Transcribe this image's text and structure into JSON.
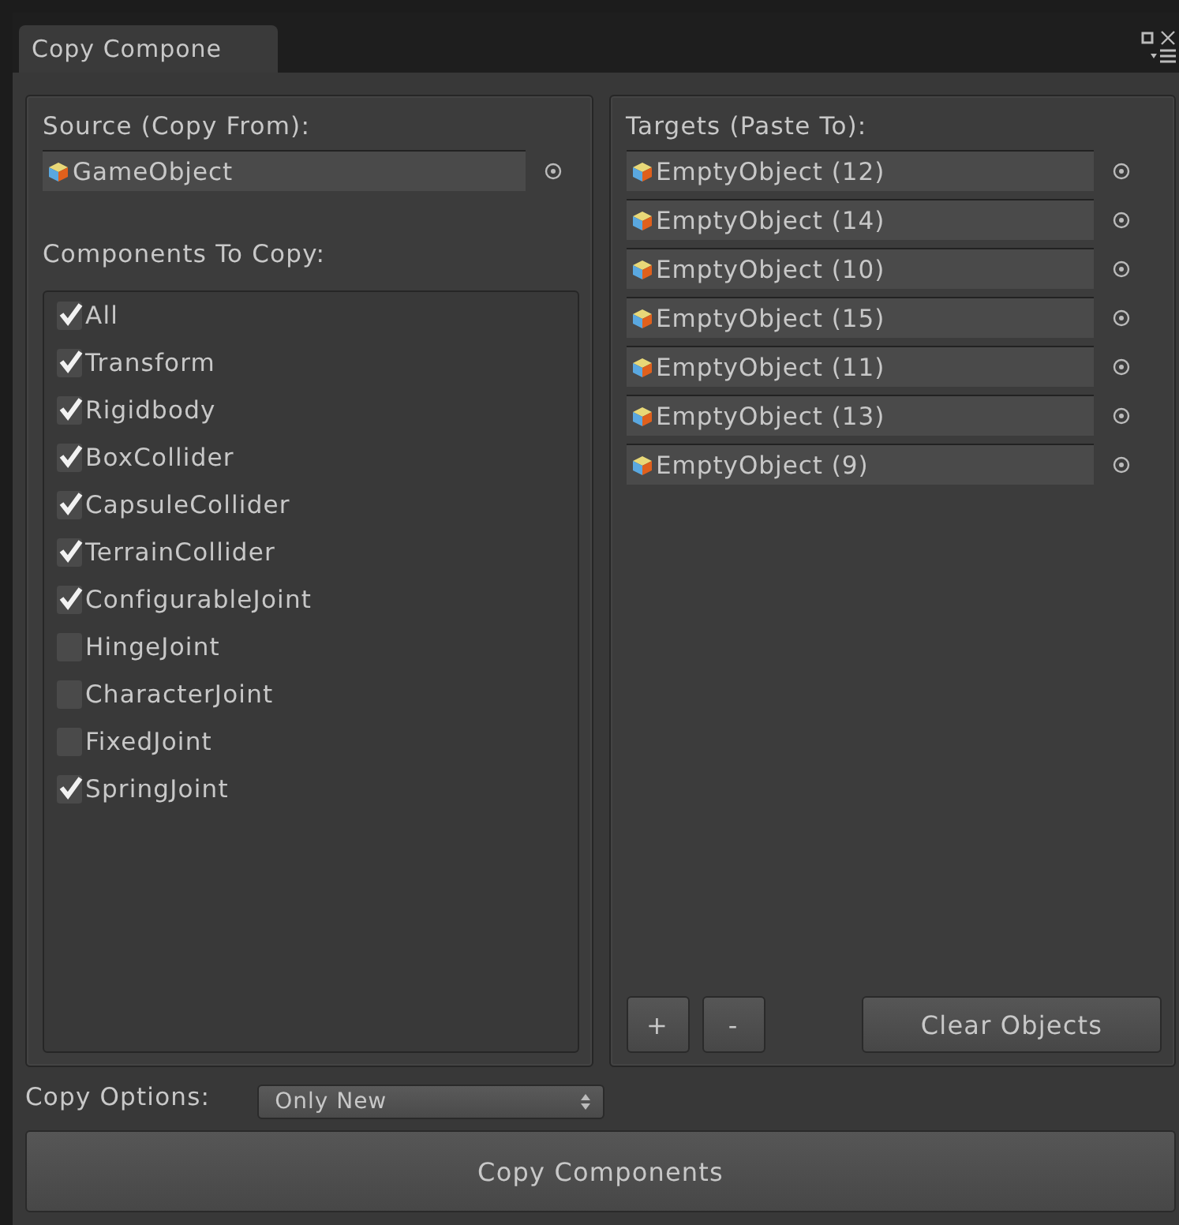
{
  "tab": {
    "title": "Copy Compone"
  },
  "source": {
    "label": "Source (Copy From):",
    "value": "GameObject"
  },
  "components": {
    "label": "Components To Copy:",
    "items": [
      {
        "label": "All",
        "checked": true
      },
      {
        "label": "Transform",
        "checked": true
      },
      {
        "label": "Rigidbody",
        "checked": true
      },
      {
        "label": "BoxCollider",
        "checked": true
      },
      {
        "label": "CapsuleCollider",
        "checked": true
      },
      {
        "label": "TerrainCollider",
        "checked": true
      },
      {
        "label": "ConfigurableJoint",
        "checked": true
      },
      {
        "label": "HingeJoint",
        "checked": false
      },
      {
        "label": "CharacterJoint",
        "checked": false
      },
      {
        "label": "FixedJoint",
        "checked": false
      },
      {
        "label": "SpringJoint",
        "checked": true
      }
    ]
  },
  "targets": {
    "label": "Targets (Paste To):",
    "items": [
      "EmptyObject (12)",
      "EmptyObject (14)",
      "EmptyObject (10)",
      "EmptyObject (15)",
      "EmptyObject (11)",
      "EmptyObject (13)",
      "EmptyObject (9)"
    ],
    "add_button": "+",
    "remove_button": "-",
    "clear_button": "Clear Objects"
  },
  "copy_options": {
    "label": "Copy Options:",
    "value": "Only New"
  },
  "copy_button": "Copy Components"
}
